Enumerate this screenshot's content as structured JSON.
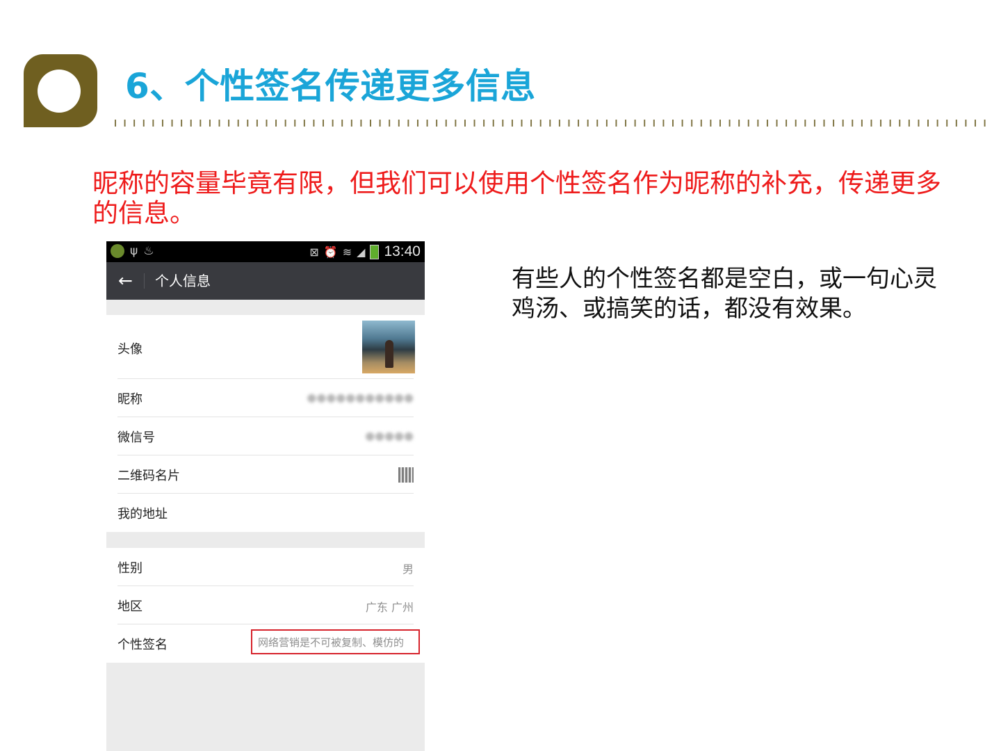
{
  "slide": {
    "title": "6、个性签名传递更多信息",
    "intro": "昵称的容量毕竟有限，但我们可以使用个性签名作为昵称的补充，传递更多的信息。",
    "side_note": "有些人的个性签名都是空白，或一句心灵鸡汤、或搞笑的话，都没有效果。"
  },
  "phone": {
    "status_bar": {
      "time": "13:40",
      "left_icons": [
        "app-icon",
        "usb-icon",
        "steam-icon"
      ],
      "right_icons": [
        "mute-icon",
        "alarm-icon",
        "wifi-icon",
        "signal-icon",
        "battery-icon"
      ]
    },
    "header": {
      "back_icon": "←",
      "title": "个人信息"
    },
    "rows": {
      "avatar": {
        "label": "头像"
      },
      "nickname": {
        "label": "昵称",
        "value": "●●●●●●●●●●●"
      },
      "wechat_id": {
        "label": "微信号",
        "value": "●●●●●"
      },
      "qr_card": {
        "label": "二维码名片"
      },
      "address": {
        "label": "我的地址"
      },
      "gender": {
        "label": "性别",
        "value": "男"
      },
      "region": {
        "label": "地区",
        "value": "广东 广州"
      },
      "signature": {
        "label": "个性签名",
        "value": "网络营销是不可被复制、模仿的"
      }
    }
  },
  "colors": {
    "title": "#1aa5d8",
    "intro": "#ee1b1b",
    "logo": "#6f5f20",
    "highlight_box": "#d6222a",
    "phone_header": "#393a3f"
  }
}
